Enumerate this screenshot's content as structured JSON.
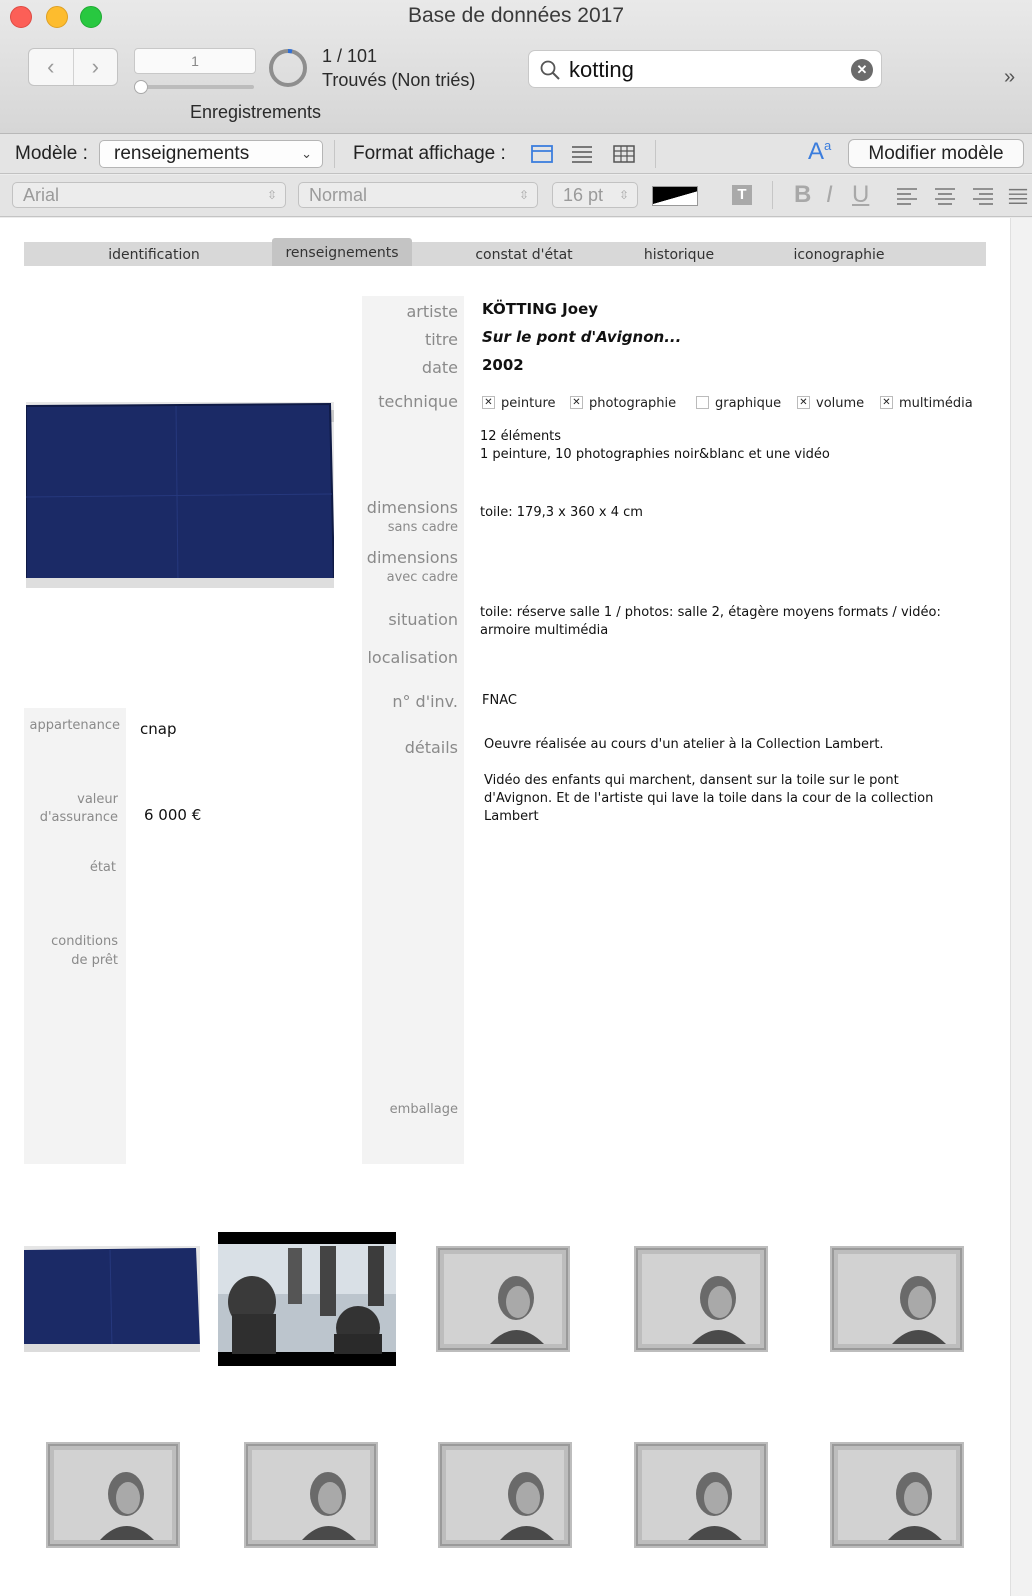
{
  "window": {
    "title": "Base de données 2017"
  },
  "toolbar": {
    "record_number": "1",
    "found_count": "1 / 101",
    "found_state": "Trouvés (Non triés)",
    "records_label": "Enregistrements",
    "search_value": "kotting",
    "overflow": "»"
  },
  "model_bar": {
    "model_label": "Modèle :",
    "model_value": "renseignements",
    "format_label": "Format affichage :",
    "modify_label": "Modifier modèle"
  },
  "format_bar": {
    "font": "Arial",
    "style": "Normal",
    "size": "16 pt",
    "bold": "B",
    "italic": "I",
    "underline": "U",
    "text_icon": "T"
  },
  "tabs": [
    {
      "label": "identification"
    },
    {
      "label": "renseignements"
    },
    {
      "label": "constat d'état"
    },
    {
      "label": "historique"
    },
    {
      "label": "iconographie"
    }
  ],
  "record": {
    "artiste_label": "artiste",
    "artiste": "KÖTTING Joey",
    "titre_label": "titre",
    "titre": "Sur le pont d'Avignon...",
    "date_label": "date",
    "date": "2002",
    "technique_label": "technique",
    "techniques": [
      {
        "label": "peinture",
        "checked": true
      },
      {
        "label": "photographie",
        "checked": true
      },
      {
        "label": "graphique",
        "checked": false
      },
      {
        "label": "volume",
        "checked": true
      },
      {
        "label": "multimédia",
        "checked": true
      }
    ],
    "technique_line1": "12 éléments",
    "technique_line2": "1 peinture, 10 photographies noir&blanc et une vidéo",
    "dimensions_label": "dimensions",
    "sans_cadre_label": "sans cadre",
    "avec_cadre_label": "avec cadre",
    "dimensions_sans_cadre": "toile: 179,3 x 360 x 4 cm",
    "situation_label": "situation",
    "situation_line1": "toile: réserve salle 1 / photos: salle 2, étagère moyens formats / vidéo:",
    "situation_line2": "armoire multimédia",
    "localisation_label": "localisation",
    "inv_label": "n° d'inv.",
    "inv": "FNAC",
    "details_label": "détails",
    "details_line1": "Oeuvre réalisée au cours d'un atelier à la Collection Lambert.",
    "details_line2": "Vidéo des enfants qui marchent, dansent sur la toile sur le pont",
    "details_line3": "d'Avignon. Et de l'artiste qui lave la toile dans la cour de la collection",
    "details_line4": "Lambert",
    "emballage_label": "emballage",
    "appartenance_label": "appartenance",
    "appartenance": "cnap",
    "valeur_label1": "valeur",
    "valeur_label2": "d'assurance",
    "valeur": "6 000 €",
    "etat_label": "état",
    "conditions_label1": "conditions",
    "conditions_label2": "de prêt"
  },
  "colors": {
    "accent": "#3b7ddd",
    "canvas_blue": "#1b2a66"
  }
}
